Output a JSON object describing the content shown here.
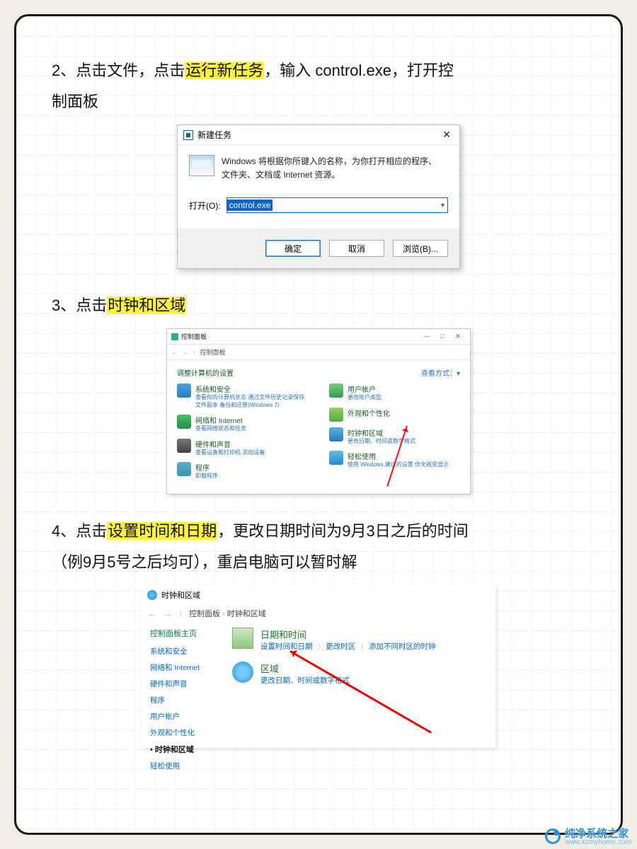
{
  "step2": {
    "pre": "2、点击文件，点击",
    "hl": "运行新任务",
    "post1": "，输入 control.exe，打开控",
    "post2": "制面板"
  },
  "dlg1": {
    "title": "新建任务",
    "close": "✕",
    "msg1": "Windows 将根据你所键入的名称，为你打开相应的程序、",
    "msg2": "文件夹、文档或 Internet 资源。",
    "open_label": "打开(O):",
    "open_value": "control.exe",
    "ok": "确定",
    "cancel": "取消",
    "browse": "浏览(B)..."
  },
  "step3": {
    "pre": "3、点击",
    "hl": "时钟和区域"
  },
  "cp": {
    "title": "控制面板",
    "breadcrumb": "控制面板",
    "head_left": "调整计算机的设置",
    "head_right": "查看方式：▾",
    "items_left": [
      {
        "t": "系统和安全",
        "s": "查看你的计算机状态\n通过文件历史记录保存文件副本\n备份和还原(Windows 7)"
      },
      {
        "t": "网络和 Internet",
        "s": "查看网络状态和任务"
      },
      {
        "t": "硬件和声音",
        "s": "查看设备和打印机\n添加设备"
      },
      {
        "t": "程序",
        "s": "卸载程序"
      }
    ],
    "items_right": [
      {
        "t": "用户帐户",
        "s": "更改账户类型"
      },
      {
        "t": "外观和个性化",
        "s": ""
      },
      {
        "t": "时钟和区域",
        "s": "更改日期、时间或数字格式"
      },
      {
        "t": "轻松使用",
        "s": "使用 Windows 建议的设置\n优化视觉显示"
      }
    ]
  },
  "step4": {
    "pre": "4、点击",
    "hl": "设置时间和日期",
    "post1": "，更改日期时间为9月3日之后的时间",
    "post2": "（例9月5号之后均可），重启电脑可以暂时解"
  },
  "cp3": {
    "top_title": "时钟和区域",
    "bc1": "控制面板",
    "bc2": "时钟和区域",
    "side_head": "控制面板主页",
    "side": [
      "系统和安全",
      "网络和 Internet",
      "硬件和声音",
      "程序",
      "用户帐户",
      "外观和个性化"
    ],
    "side_current": "时钟和区域",
    "side_last": "轻松使用",
    "row1_title": "日期和时间",
    "row1_links": [
      "设置时间和日期",
      "更改时区",
      "添加不同时区的时钟"
    ],
    "row2_title": "区域",
    "row2_sub": "更改日期、时间或数字格式"
  },
  "watermark": {
    "name": "纯净系统之家",
    "url": "www.kzmyhome.com"
  }
}
